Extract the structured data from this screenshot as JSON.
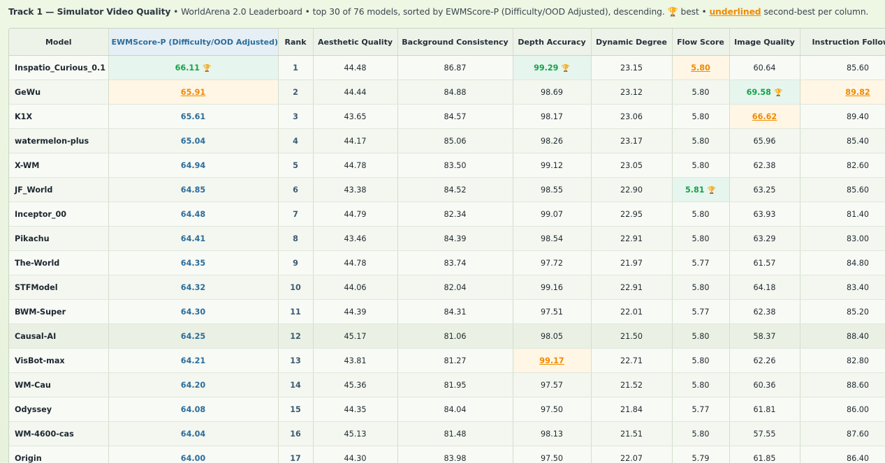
{
  "caption": {
    "track": "Track 1 — Simulator Video Quality",
    "text_before_trophy": " • WorldArena 2.0 Leaderboard • top 30 of 76 models, sorted by EWMScore-P (Difficulty/OOD Adjusted), descending. ",
    "trophy": "🏆",
    "best_text": " best • ",
    "underlined": "underlined",
    "second_text": " second-best per column."
  },
  "colors": {
    "best": "#16a34a",
    "second": "#f08a00",
    "ewms": "#2c6d9c",
    "trophy": "#c79211"
  },
  "columns": [
    "Model",
    "EWMScore-P (Difficulty/OOD Adjusted)",
    "Rank",
    "Aesthetic Quality",
    "Background Consistency",
    "Depth Accuracy",
    "Dynamic Degree",
    "Flow Score",
    "Image Quality",
    "Instruction Following"
  ],
  "rows": [
    [
      "Inspatio_Curious_0.1",
      "66.11",
      "1",
      "44.48",
      "86.87",
      "99.29",
      "23.15",
      "5.80",
      "60.64",
      "85.60"
    ],
    [
      "GeWu",
      "65.91",
      "2",
      "44.44",
      "84.88",
      "98.69",
      "23.12",
      "5.80",
      "69.58",
      "89.82"
    ],
    [
      "K1X",
      "65.61",
      "3",
      "43.65",
      "84.57",
      "98.17",
      "23.06",
      "5.80",
      "66.62",
      "89.40"
    ],
    [
      "watermelon-plus",
      "65.04",
      "4",
      "44.17",
      "85.06",
      "98.26",
      "23.17",
      "5.80",
      "65.96",
      "85.40"
    ],
    [
      "X-WM",
      "64.94",
      "5",
      "44.78",
      "83.50",
      "99.12",
      "23.05",
      "5.80",
      "62.38",
      "82.60"
    ],
    [
      "JF_World",
      "64.85",
      "6",
      "43.38",
      "84.52",
      "98.55",
      "22.90",
      "5.81",
      "63.25",
      "85.60"
    ],
    [
      "Inceptor_00",
      "64.48",
      "7",
      "44.79",
      "82.34",
      "99.07",
      "22.95",
      "5.80",
      "63.93",
      "81.40"
    ],
    [
      "Pikachu",
      "64.41",
      "8",
      "43.46",
      "84.39",
      "98.54",
      "22.91",
      "5.80",
      "63.29",
      "83.00"
    ],
    [
      "The-World",
      "64.35",
      "9",
      "44.78",
      "83.74",
      "97.72",
      "21.97",
      "5.77",
      "61.57",
      "84.80"
    ],
    [
      "STFModel",
      "64.32",
      "10",
      "44.06",
      "82.04",
      "99.16",
      "22.91",
      "5.80",
      "64.18",
      "83.40"
    ],
    [
      "BWM-Super",
      "64.30",
      "11",
      "44.39",
      "84.31",
      "97.51",
      "22.01",
      "5.77",
      "62.38",
      "85.20"
    ],
    [
      "Causal-AI",
      "64.25",
      "12",
      "45.17",
      "81.06",
      "98.05",
      "21.50",
      "5.80",
      "58.37",
      "88.40"
    ],
    [
      "VisBot-max",
      "64.21",
      "13",
      "43.81",
      "81.27",
      "99.17",
      "22.71",
      "5.80",
      "62.26",
      "82.80"
    ],
    [
      "WM-Cau",
      "64.20",
      "14",
      "45.36",
      "81.95",
      "97.57",
      "21.52",
      "5.80",
      "60.36",
      "88.60"
    ],
    [
      "Odyssey",
      "64.08",
      "15",
      "44.35",
      "84.04",
      "97.50",
      "21.84",
      "5.77",
      "61.81",
      "86.00"
    ],
    [
      "WM-4600-cas",
      "64.04",
      "16",
      "45.13",
      "81.48",
      "98.13",
      "21.51",
      "5.80",
      "57.55",
      "87.60"
    ],
    [
      "Origin",
      "64.00",
      "17",
      "44.30",
      "83.98",
      "97.50",
      "22.07",
      "5.79",
      "61.85",
      "86.40"
    ]
  ],
  "best_cells": [
    [
      0,
      1
    ],
    [
      0,
      5
    ],
    [
      5,
      7
    ],
    [
      1,
      8
    ]
  ],
  "second_cells": [
    [
      1,
      1
    ],
    [
      0,
      7
    ],
    [
      1,
      9
    ],
    [
      2,
      8
    ],
    [
      12,
      5
    ]
  ],
  "highlighted_row": 11
}
